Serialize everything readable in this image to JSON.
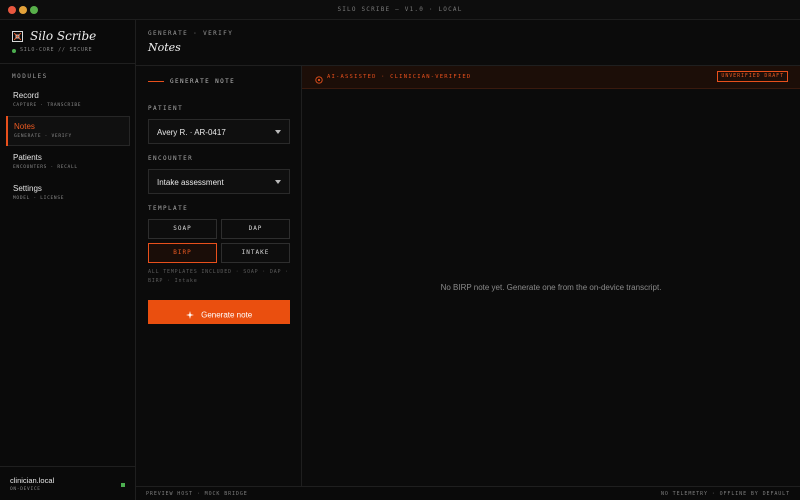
{
  "window": {
    "title": "SILO SCRIBE — V1.0 · LOCAL"
  },
  "sidebar": {
    "brand_name": "Silo Scribe",
    "brand_status": "SILO-CORE // SECURE",
    "modules_heading": "MODULES",
    "items": [
      {
        "label": "Record",
        "sub": "CAPTURE · TRANSCRIBE",
        "active": false
      },
      {
        "label": "Notes",
        "sub": "GENERATE · VERIFY",
        "active": true
      },
      {
        "label": "Patients",
        "sub": "ENCOUNTERS · RECALL",
        "active": false
      },
      {
        "label": "Settings",
        "sub": "MODEL · LICENSE",
        "active": false
      }
    ],
    "footer": {
      "host": "clinician.local",
      "host_sub": "ON-DEVICE"
    }
  },
  "header": {
    "eyebrow": "GENERATE · VERIFY",
    "title": "Notes"
  },
  "form": {
    "section_title": "GENERATE NOTE",
    "patient_label": "PATIENT",
    "patient_value": "Avery R. · AR-0417",
    "encounter_label": "ENCOUNTER",
    "encounter_value": "Intake assessment",
    "template_label": "TEMPLATE",
    "templates": [
      {
        "label": "SOAP",
        "selected": false
      },
      {
        "label": "DAP",
        "selected": false
      },
      {
        "label": "BIRP",
        "selected": true
      },
      {
        "label": "INTAKE",
        "selected": false
      }
    ],
    "template_note": "ALL TEMPLATES INCLUDED · SOAP · DAP · BIRP · Intake",
    "generate_label": "Generate note"
  },
  "note": {
    "banner_text": "AI-ASSISTED · CLINICIAN-VERIFIED",
    "badge": "UNVERIFIED DRAFT",
    "empty_state": "No BIRP note yet. Generate one from the on-device transcript."
  },
  "footer": {
    "left": "PREVIEW HOST · MOCK BRIDGE",
    "right": "NO TELEMETRY · OFFLINE BY DEFAULT"
  },
  "colors": {
    "accent": "#ea4f0f",
    "status_ok": "#4caf50",
    "background": "#0b0b0b"
  }
}
